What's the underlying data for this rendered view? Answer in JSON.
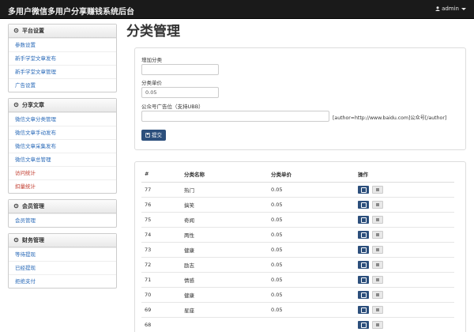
{
  "header": {
    "title": "多用户微信多用户分享赚钱系统后台",
    "user": "admin",
    "user_icon": "user-icon",
    "caret_icon": "caret-down-icon"
  },
  "sidebar": {
    "sections": [
      {
        "title": "平台设置",
        "icon": "gear-icon",
        "items": [
          {
            "label": "参数设置"
          },
          {
            "label": "新手学堂文章发布"
          },
          {
            "label": "新手学堂文章管理"
          },
          {
            "label": "广告设置"
          }
        ]
      },
      {
        "title": "分享文章",
        "icon": "gear-icon",
        "items": [
          {
            "label": "微信文章分类管理"
          },
          {
            "label": "微信文章手动发布"
          },
          {
            "label": "微信文章采集发布"
          },
          {
            "label": "微信文章总管理"
          },
          {
            "label": "访问统计",
            "red": true
          },
          {
            "label": "扣量统计",
            "red": true
          }
        ]
      },
      {
        "title": "会员管理",
        "icon": "gear-icon",
        "items": [
          {
            "label": "会员管理"
          }
        ]
      },
      {
        "title": "财务管理",
        "icon": "gear-icon",
        "items": [
          {
            "label": "等待提现"
          },
          {
            "label": "已经提现"
          },
          {
            "label": "拒绝支付"
          }
        ]
      }
    ]
  },
  "main": {
    "title": "分类管理",
    "form": {
      "add_label": "增加分类",
      "add_value": "",
      "price_label": "分类单价",
      "price_value": "0.05",
      "ad_label": "公众号广告位（支持UBB）",
      "ad_value": "",
      "ad_hint": "[author=http://www.baidu.com]公众号[/author]",
      "submit_label": "提交",
      "submit_icon": "save-icon"
    },
    "table": {
      "headers": [
        "#",
        "分类名称",
        "分类单价",
        "操作"
      ],
      "edit_icon": "edit-icon",
      "delete_icon": "delete-icon",
      "rows": [
        {
          "id": "77",
          "name": "热门",
          "price": "0.05"
        },
        {
          "id": "76",
          "name": "搞笑",
          "price": "0.05"
        },
        {
          "id": "75",
          "name": "奇闻",
          "price": "0.05"
        },
        {
          "id": "74",
          "name": "两性",
          "price": "0.05"
        },
        {
          "id": "73",
          "name": "健康",
          "price": "0.05"
        },
        {
          "id": "72",
          "name": "励志",
          "price": "0.05"
        },
        {
          "id": "71",
          "name": "情感",
          "price": "0.05"
        },
        {
          "id": "70",
          "name": "健康",
          "price": "0.05"
        },
        {
          "id": "69",
          "name": "星座",
          "price": "0.05"
        },
        {
          "id": "68",
          "name": "",
          "price": ""
        }
      ]
    }
  }
}
